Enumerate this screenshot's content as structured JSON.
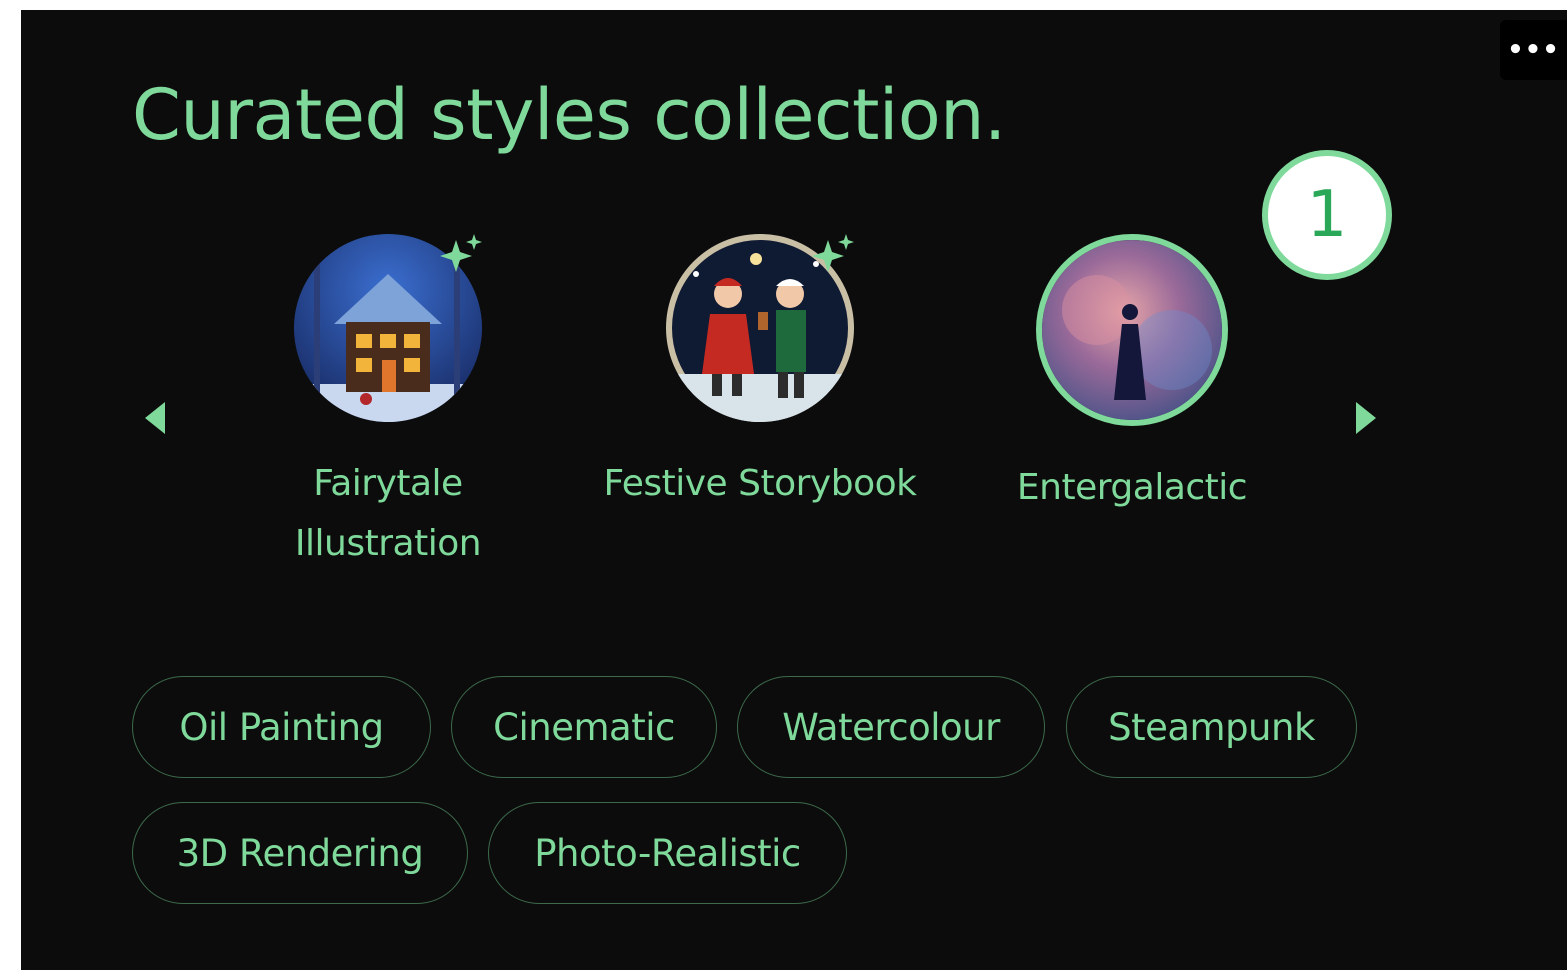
{
  "title": "Curated styles collection.",
  "more_button": "•••",
  "step_badge": "1",
  "carousel": {
    "prev_icon": "chevron-left-icon",
    "next_icon": "chevron-right-icon",
    "items": [
      {
        "label": "Fairytale Illustration",
        "icon": "sparkle-icon",
        "selected": false
      },
      {
        "label": "Festive Storybook",
        "icon": "sparkle-icon",
        "selected": false
      },
      {
        "label": "Entergalactic",
        "selected": true
      }
    ]
  },
  "chips": [
    "Oil Painting",
    "Cinematic",
    "Watercolour",
    "Steampunk",
    "3D Rendering",
    "Photo-Realistic"
  ],
  "colors": {
    "accent": "#7ed99a",
    "background": "#0c0c0c",
    "chip_border": "#3c6a4b"
  }
}
